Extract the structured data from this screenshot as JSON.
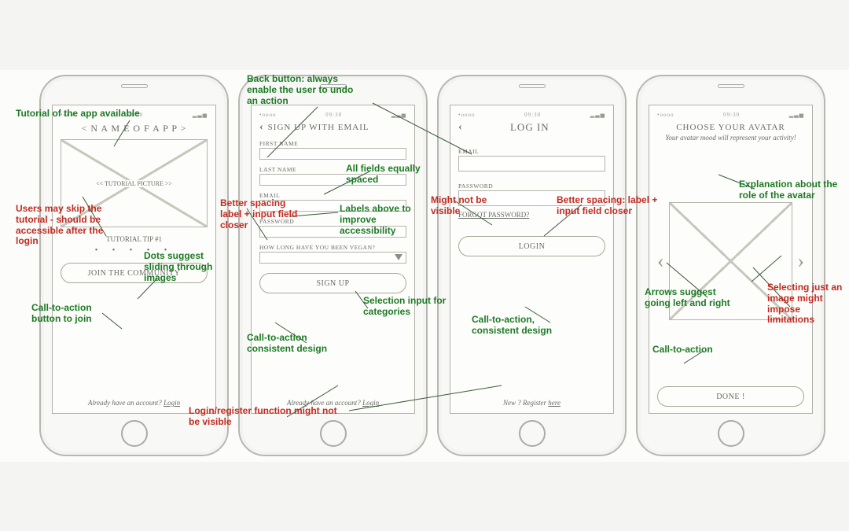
{
  "phone_status": {
    "left": "•oooo",
    "center": "09:30",
    "right": "▂▃▅"
  },
  "screen1": {
    "title": "< N A M E O F A P P >",
    "picture_label": "<< TUTORIAL PICTURE >>",
    "caption": "TUTORIAL TIP #1",
    "dots": "• • • • •",
    "cta": "JOIN THE COMMUNITY",
    "footer_pre": "Already have an account? ",
    "footer_link": "Login"
  },
  "screen2": {
    "title": "SIGN UP WITH EMAIL",
    "fields": {
      "firstname": "FIRST NAME",
      "lastname": "LAST NAME",
      "email": "EMAIL",
      "password": "PASSWORD",
      "duration": "HOW LONG HAVE YOU BEEN VEGAN?"
    },
    "cta": "SIGN  UP",
    "footer_pre": "Already have an account? ",
    "footer_link": "Login"
  },
  "screen3": {
    "title": "LOG IN",
    "fields": {
      "email": "EMAIL",
      "password": "PASSWORD"
    },
    "forgot": "FORGOT PASSWORD?",
    "cta": "LOGIN",
    "footer_pre": "New ? ",
    "footer_mid": "Register ",
    "footer_link": "here"
  },
  "screen4": {
    "title": "CHOOSE YOUR AVATAR",
    "subtitle": "Your avatar mood will represent your activity!",
    "cta": "DONE !"
  },
  "annotations": {
    "tutorial_available": "Tutorial of the app available",
    "skip_tutorial": "Users may skip the tutorial - should be accessible after the login",
    "dots_suggest": "Dots suggest sliding through images",
    "cta_join": "Call-to-action button to join",
    "back_button": "Back button: always enable the user to undo an action",
    "fields_spaced": "All fields equally spaced",
    "better_spacing_left": "Better spacing label + input field closer",
    "labels_above": "Labels above to improve accessibility",
    "select_cat": "Selection input for categories",
    "cta_consistent": "Call-to-action consistent design",
    "login_reg_visible": "Login/register function might not be visible",
    "might_not_visible": "Might not be visible",
    "better_spacing_right": "Better spacing: label + input field closer",
    "cta_consistent2": "Call-to-action, consistent design",
    "explain_avatar": "Explanation about the role of the avatar",
    "arrows_lr": "Arrows suggest going left and right",
    "select_limit": "Selecting just an image might impose limitations",
    "cta4": "Call-to-action"
  }
}
